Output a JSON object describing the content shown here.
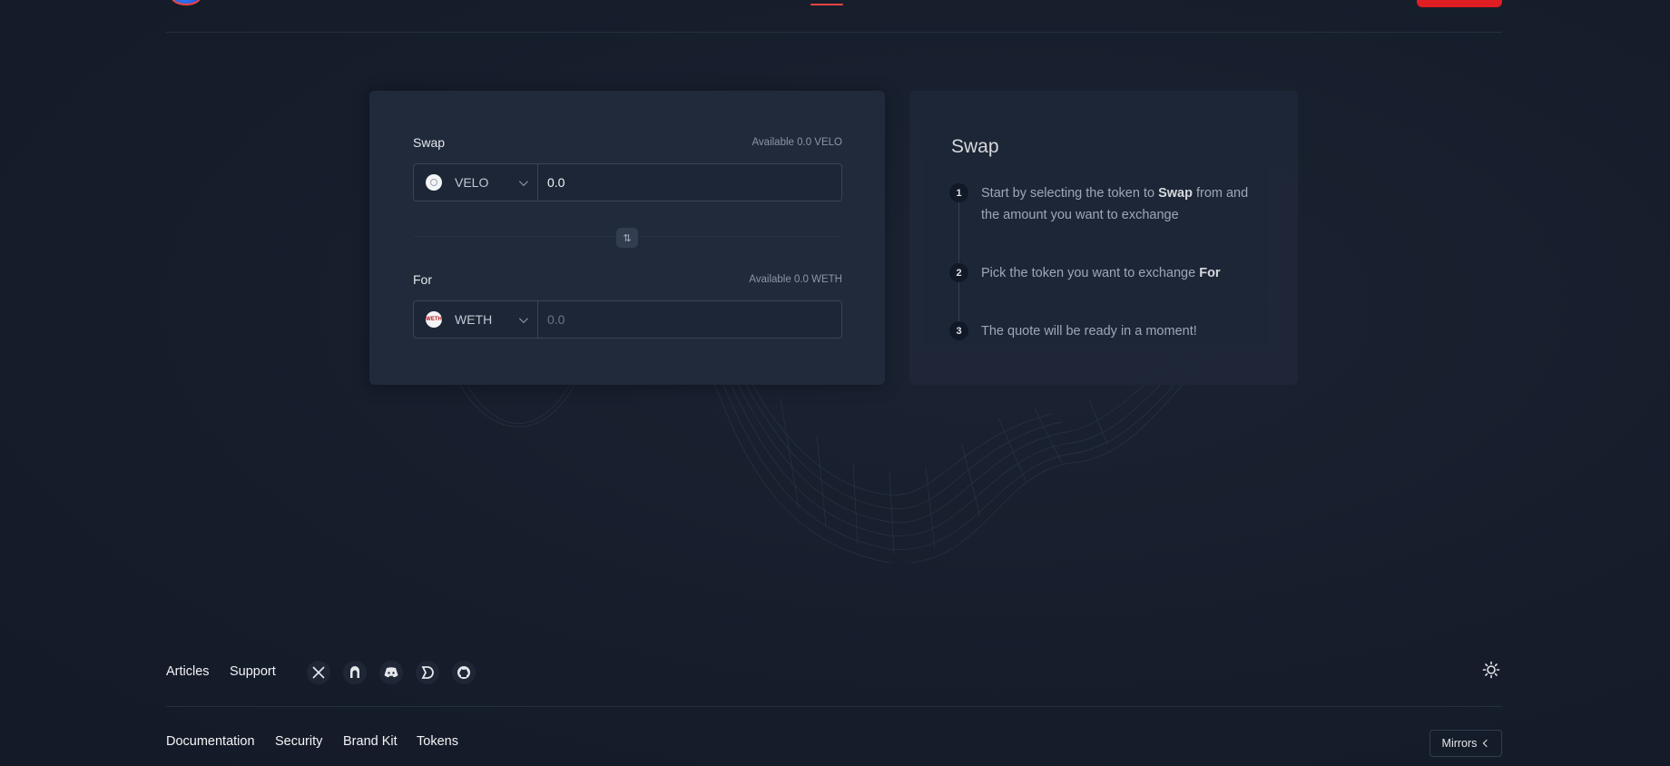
{
  "swap": {
    "from_label": "Swap",
    "from_available": "Available 0.0 VELO",
    "from_token": "VELO",
    "from_amount": "0.0",
    "to_label": "For",
    "to_available": "Available 0.0 WETH",
    "to_token": "WETH",
    "to_token_icon_text": "WETH",
    "to_amount_placeholder": "0.0",
    "toggle_icon": "⇅"
  },
  "info": {
    "title": "Swap",
    "steps": [
      {
        "num": "1",
        "pre": "Start by selecting the token to ",
        "bold": "Swap",
        "post": " from and the amount you want to exchange"
      },
      {
        "num": "2",
        "pre": "Pick the token you want to exchange ",
        "bold": "For",
        "post": ""
      },
      {
        "num": "3",
        "pre": "The quote will be ready in a moment!",
        "bold": "",
        "post": ""
      }
    ]
  },
  "footer": {
    "top_links": [
      "Articles",
      "Support"
    ],
    "social_icons": [
      "x-icon",
      "mirror-icon",
      "discord-icon",
      "dune-icon",
      "github-icon"
    ],
    "bottom_links": [
      "Documentation",
      "Security",
      "Brand Kit",
      "Tokens"
    ],
    "mirrors_label": "Mirrors"
  },
  "colors": {
    "background": "#161d2b",
    "card": "#202a3b",
    "accent": "#e11d24"
  }
}
